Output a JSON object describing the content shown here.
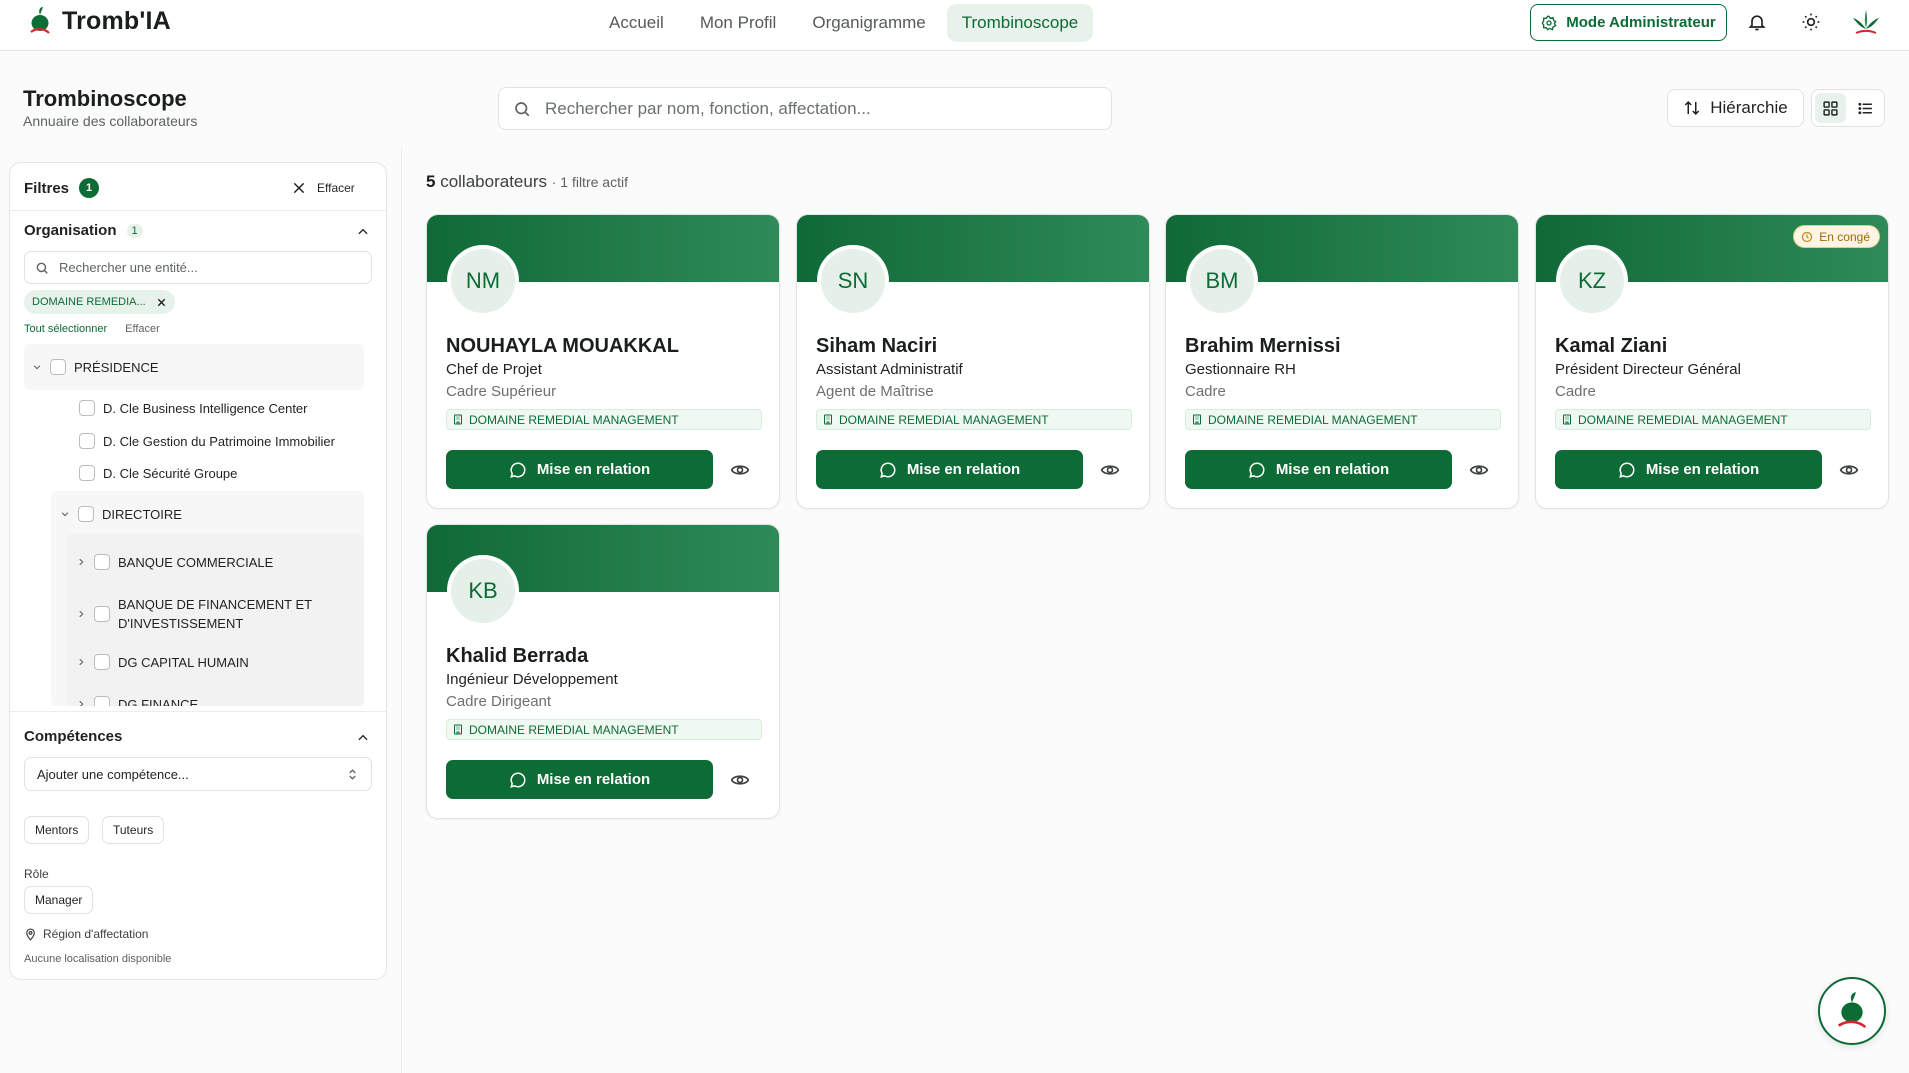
{
  "app": {
    "title": "Tromb'IA"
  },
  "nav": {
    "items": [
      "Accueil",
      "Mon Profil",
      "Organigramme",
      "Trombinoscope"
    ],
    "active": "Trombinoscope"
  },
  "header": {
    "admin_label": "Mode Administrateur"
  },
  "page": {
    "title": "Trombinoscope",
    "subtitle": "Annuaire des collaborateurs"
  },
  "search": {
    "placeholder": "Rechercher par nom, fonction, affectation..."
  },
  "toolbar": {
    "hierarchy_label": "Hiérarchie"
  },
  "filters": {
    "title": "Filtres",
    "active_count": "1",
    "clear_label": "Effacer",
    "organisation": {
      "label": "Organisation",
      "count": "1",
      "search_placeholder": "Rechercher une entité...",
      "selected_chip": "DOMAINE REMEDIA...",
      "select_all": "Tout sélectionner",
      "clear": "Effacer",
      "tree": {
        "root": "PRÉSIDENCE",
        "children": [
          "D. Cle Business Intelligence Center",
          "D. Cle Gestion du Patrimoine Immobilier",
          "D. Cle Sécurité Groupe"
        ],
        "directoire": "DIRECTOIRE",
        "directoire_children": [
          "BANQUE COMMERCIALE",
          "BANQUE DE FINANCEMENT ET D'INVESTISSEMENT",
          "DG CAPITAL HUMAIN",
          "DG FINANCE"
        ]
      }
    },
    "competences": {
      "label": "Compétences",
      "placeholder": "Ajouter une compétence..."
    },
    "mentors_label": "Mentors",
    "tuteurs_label": "Tuteurs",
    "role": {
      "label": "Rôle",
      "manager": "Manager"
    },
    "region": {
      "label": "Région d'affectation",
      "empty": "Aucune localisation disponible"
    }
  },
  "results": {
    "count": "5",
    "count_label": "collaborateurs",
    "filter_info": "· 1 filtre actif"
  },
  "cards": [
    {
      "initials": "NM",
      "name": "NOUHAYLA MOUAKKAL",
      "function": "Chef de Projet",
      "grade": "Cadre Supérieur",
      "domain": "DOMAINE REMEDIAL MANAGEMENT",
      "status": ""
    },
    {
      "initials": "SN",
      "name": "Siham Naciri",
      "function": "Assistant Administratif",
      "grade": "Agent de Maîtrise",
      "domain": "DOMAINE REMEDIAL MANAGEMENT",
      "status": ""
    },
    {
      "initials": "BM",
      "name": "Brahim Mernissi",
      "function": "Gestionnaire RH",
      "grade": "Cadre",
      "domain": "DOMAINE REMEDIAL MANAGEMENT",
      "status": ""
    },
    {
      "initials": "KZ",
      "name": "Kamal Ziani",
      "function": "Président Directeur Général",
      "grade": "Cadre",
      "domain": "DOMAINE REMEDIAL MANAGEMENT",
      "status": "En congé"
    },
    {
      "initials": "KB",
      "name": "Khalid Berrada",
      "function": "Ingénieur Développement",
      "grade": "Cadre Dirigeant",
      "domain": "DOMAINE REMEDIAL MANAGEMENT",
      "status": ""
    }
  ],
  "card_action_label": "Mise en relation",
  "colors": {
    "brand": "#0d6b36",
    "accent_light": "#e6f2ea",
    "leave": "#e9c885"
  }
}
